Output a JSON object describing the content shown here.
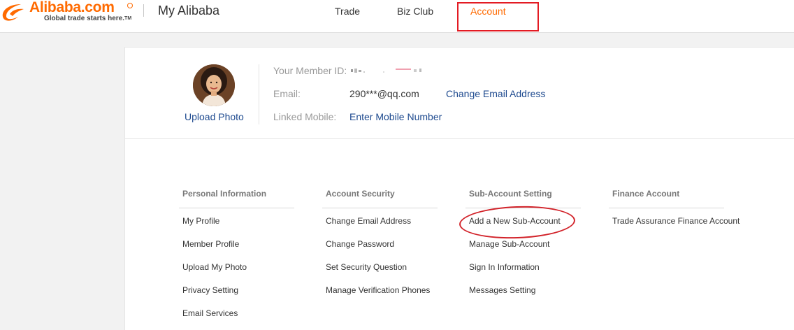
{
  "header": {
    "logo": {
      "wordmark": "Alibaba.com",
      "tagline": "Global trade starts here.",
      "trademark": "TM"
    },
    "site_title": "My Alibaba",
    "nav": [
      {
        "label": "Trade"
      },
      {
        "label": "Biz Club"
      },
      {
        "label": "Account",
        "active": true
      }
    ]
  },
  "profile": {
    "upload_photo": "Upload Photo",
    "member_id_label": "Your Member ID:",
    "email_label": "Email:",
    "email_value": "290***@qq.com",
    "change_email_link": "Change Email Address",
    "mobile_label": "Linked Mobile:",
    "mobile_link": "Enter Mobile Number"
  },
  "sections": [
    {
      "title": "Personal Information",
      "items": [
        "My Profile",
        "Member Profile",
        "Upload My Photo",
        "Privacy Setting",
        "Email Services"
      ]
    },
    {
      "title": "Account Security",
      "items": [
        "Change Email Address",
        "Change Password",
        "Set Security Question",
        "Manage Verification Phones"
      ]
    },
    {
      "title": "Sub-Account Setting",
      "items": [
        "Add a New Sub-Account",
        "Manage Sub-Account",
        "Sign In Information",
        "Messages Setting"
      ]
    },
    {
      "title": "Finance Account",
      "items": [
        "Trade Assurance Finance Account"
      ]
    }
  ],
  "colors": {
    "brand": "#ff6a00",
    "link": "#1e4a8f",
    "annotation": "#d2232a"
  }
}
